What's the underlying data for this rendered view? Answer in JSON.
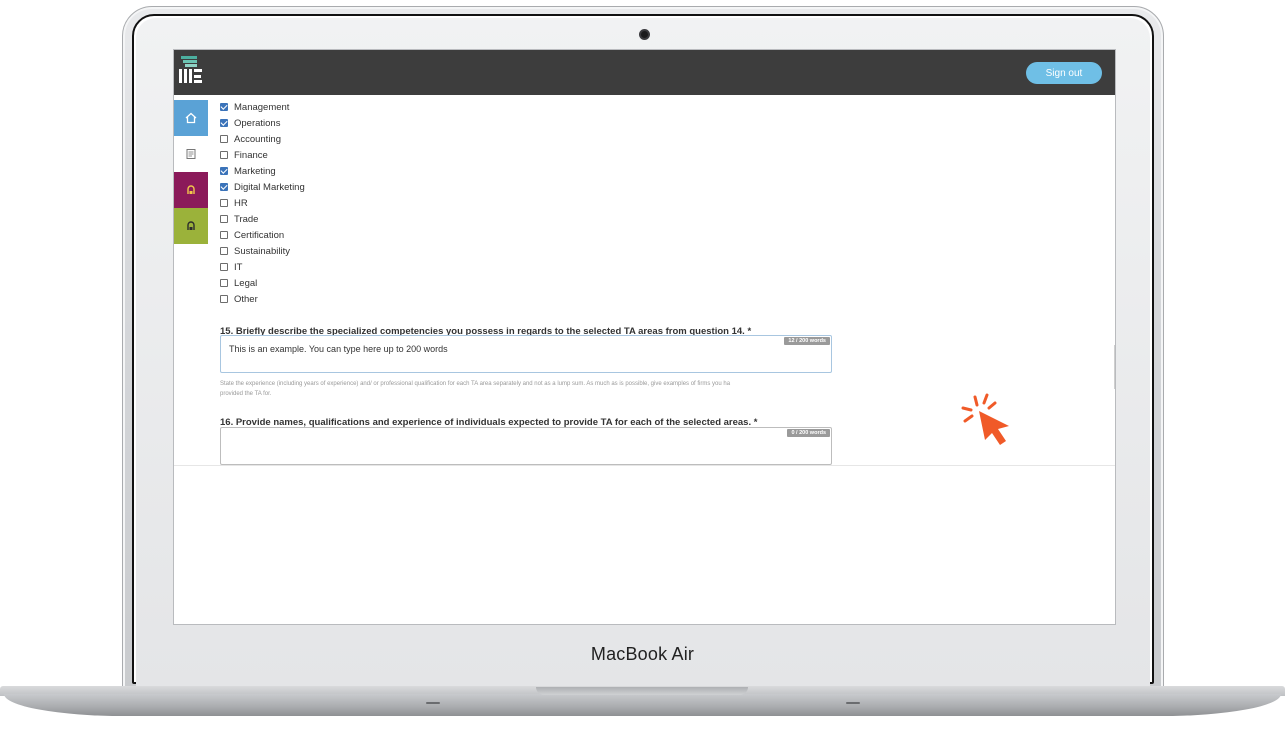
{
  "device": {
    "brand_label": "MacBook Air"
  },
  "topbar": {
    "signout_label": "Sign out"
  },
  "sidebar": {
    "items": [
      {
        "name": "home",
        "color": "#5aa2d6"
      },
      {
        "name": "document",
        "color": "#ffffff"
      },
      {
        "name": "profile-magenta",
        "color": "#8b1a5a"
      },
      {
        "name": "profile-green",
        "color": "#9bb23a"
      }
    ]
  },
  "checklist": [
    {
      "label": "Management",
      "checked": true
    },
    {
      "label": "Operations",
      "checked": true
    },
    {
      "label": "Accounting",
      "checked": false
    },
    {
      "label": "Finance",
      "checked": false
    },
    {
      "label": "Marketing",
      "checked": true
    },
    {
      "label": "Digital Marketing",
      "checked": true
    },
    {
      "label": "HR",
      "checked": false
    },
    {
      "label": "Trade",
      "checked": false
    },
    {
      "label": "Certification",
      "checked": false
    },
    {
      "label": "Sustainability",
      "checked": false
    },
    {
      "label": "IT",
      "checked": false
    },
    {
      "label": "Legal",
      "checked": false
    },
    {
      "label": "Other",
      "checked": false
    }
  ],
  "q15": {
    "label": "15. Briefly describe the specialized competencies you possess in regards to the selected TA areas from question 14. *",
    "value": "This is an example. You can type here up to 200 words",
    "word_count": "12 / 200 words",
    "hint_line1": "State the experience (including years of experience) and/ or professional qualification for each TA area separately and not as a lump sum. As much as is possible, give examples of firms you ha",
    "hint_line2": "provided the TA for."
  },
  "q16": {
    "label": "16. Provide names, qualifications and experience of individuals expected to provide TA for each of the selected areas. *",
    "value": "",
    "word_count": "0 / 200 words"
  },
  "colors": {
    "accent": "#6fbfe6",
    "topbar": "#3d3d3d",
    "pointer": "#f05a28"
  }
}
